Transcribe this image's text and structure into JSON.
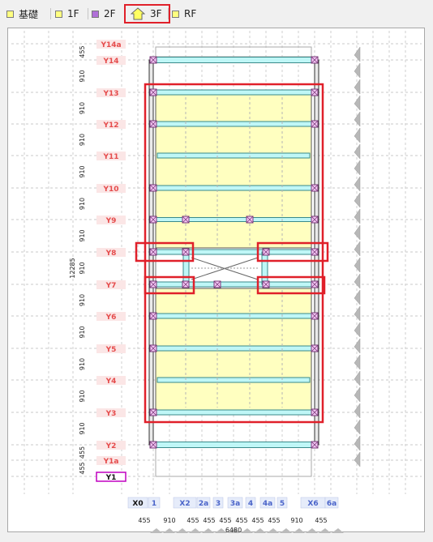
{
  "tabs": [
    {
      "label": "基礎",
      "color": "#ffff80",
      "active": false
    },
    {
      "label": "1F",
      "color": "#ffff80",
      "active": false
    },
    {
      "label": "2F",
      "color": "#b070d8",
      "active": false
    },
    {
      "label": "3F",
      "color": "#ffff80",
      "active": true,
      "icon": "house-icon"
    },
    {
      "label": "RF",
      "color": "#ffff80",
      "active": false
    }
  ],
  "grid_y_labels": [
    "Y14a",
    "Y14",
    "Y13",
    "Y12",
    "Y11",
    "Y10",
    "Y9",
    "Y8",
    "Y7",
    "Y6",
    "Y5",
    "Y4",
    "Y3",
    "Y2",
    "Y1a",
    "Y1"
  ],
  "grid_y_selected": "Y1",
  "y_dimensions": [
    "455",
    "910",
    "910",
    "910",
    "910",
    "910",
    "910",
    "910",
    "910",
    "910",
    "910",
    "910",
    "910",
    "455",
    "455"
  ],
  "y_total": "12285",
  "grid_x_labels": [
    "X0",
    "1",
    "X2",
    "2a",
    "3",
    "3a",
    "4",
    "4a",
    "5",
    "X6",
    "6a"
  ],
  "x_dimensions": [
    "455",
    "910",
    "455",
    "455",
    "455",
    "455",
    "455",
    "455",
    "910",
    "455"
  ],
  "x_total": "6480",
  "colors": {
    "label_red": "#e54b4b",
    "label_blue": "#4a64c9",
    "floor_fill": "#ffffc0",
    "beam_fill": "#bff7f7",
    "highlight": "#e0202a",
    "selected_label_border": "#c000c0"
  }
}
